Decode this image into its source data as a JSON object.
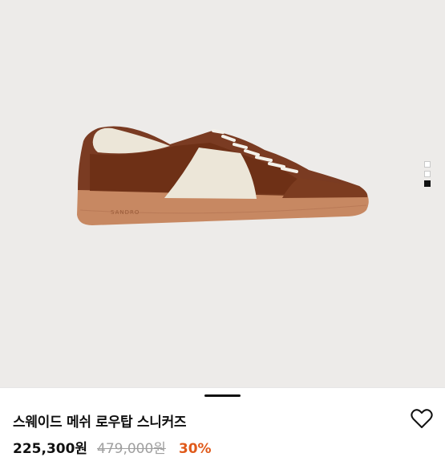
{
  "product": {
    "name": "스웨이드 메쉬 로우탑 스니커즈",
    "price": "225,300원",
    "original_price": "479,000원",
    "discount": "30%",
    "brand_mark": "SANDRO"
  },
  "gallery": {
    "dot_count": 3,
    "active_index": 2
  },
  "icons": {
    "favorite": "heart-outline-icon"
  },
  "colors": {
    "background": "#edebe9",
    "accent_discount": "#e05a1a",
    "suede_brown": "#7a3b22",
    "sole_gum": "#c78862"
  }
}
